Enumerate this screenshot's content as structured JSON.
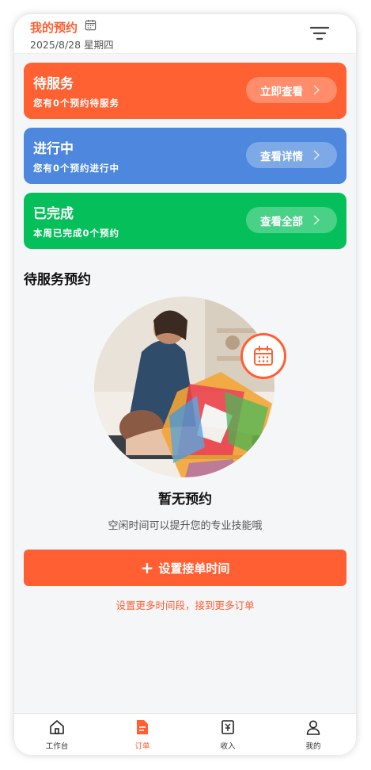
{
  "header": {
    "title": "我的预约",
    "date": "2025/8/28 星期四",
    "calendar_icon": "calendar-icon",
    "filter_icon": "filter-icon"
  },
  "cards": [
    {
      "title": "待服务",
      "subtitle": "您有0个预约待服务",
      "button": "立即查看",
      "color": "#ff6132"
    },
    {
      "title": "进行中",
      "subtitle": "您有0个预约进行中",
      "button": "查看详情",
      "color": "#4d88de"
    },
    {
      "title": "已完成",
      "subtitle": "本周已完成0个预约",
      "button": "查看全部",
      "color": "#05c05a"
    }
  ],
  "section_title": "待服务预约",
  "empty": {
    "title": "暂无预约",
    "subtitle": "空闲时间可以提升您的专业技能哦"
  },
  "main_button": {
    "icon": "plus-icon",
    "label": "设置接单时间"
  },
  "tip": "设置更多时间段，接到更多订单",
  "tabbar": [
    {
      "label": "工作台",
      "icon": "home-icon",
      "active": false
    },
    {
      "label": "订单",
      "icon": "order-icon",
      "active": true
    },
    {
      "label": "收入",
      "icon": "income-icon",
      "active": false
    },
    {
      "label": "我的",
      "icon": "user-icon",
      "active": false
    }
  ],
  "colors": {
    "accent": "#ff5f32"
  }
}
